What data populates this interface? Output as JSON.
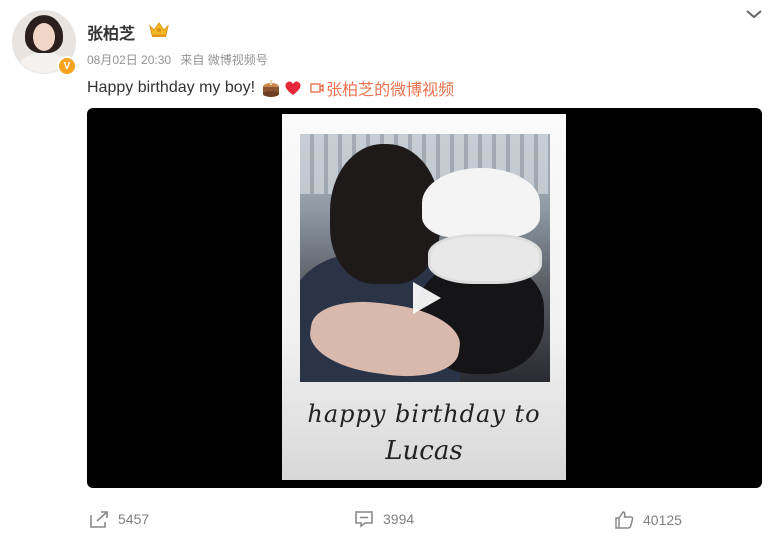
{
  "post": {
    "username": "张柏芝",
    "date": "08月02日 20:30",
    "source": "来自 微博视频号",
    "text": "Happy birthday my boy!",
    "video_link": "张柏芝的微博视频",
    "verified_badge": "V"
  },
  "video": {
    "caption_line1": "happy birthday to",
    "caption_line2": "Lucas"
  },
  "actions": {
    "share_count": "5457",
    "comment_count": "3994",
    "like_count": "40125"
  },
  "icons": {
    "crown": "crown-icon",
    "chevron": "chevron-down-icon",
    "cake": "cake-emoji-icon",
    "heart": "heart-emoji-icon",
    "video": "video-icon",
    "play": "play-icon",
    "share": "share-icon",
    "comment": "comment-icon",
    "like": "like-icon"
  },
  "colors": {
    "link": "#eb7350",
    "meta": "#939393",
    "badge": "#f7a31b"
  }
}
